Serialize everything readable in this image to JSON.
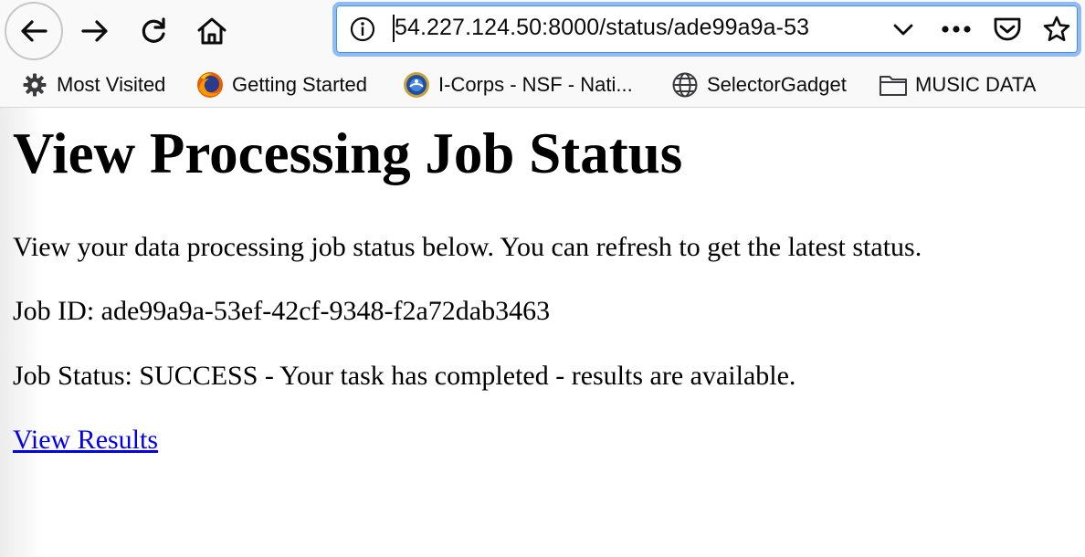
{
  "browser": {
    "url": "54.227.124.50:8000/status/ade99a9a-53",
    "icons": {
      "back": "back-arrow-icon",
      "forward": "forward-arrow-icon",
      "reload": "reload-icon",
      "home": "home-icon",
      "info": "info-icon",
      "dropdown": "chevron-down-icon",
      "more": "more-dots-icon",
      "pocket": "pocket-icon",
      "bookmark": "star-icon"
    },
    "accent_color": "#8fbcf5"
  },
  "bookmarks": [
    {
      "label": "Most Visited",
      "icon": "gear-icon"
    },
    {
      "label": "Getting Started",
      "icon": "firefox-icon"
    },
    {
      "label": "I-Corps - NSF - Nati...",
      "icon": "nsf-seal-icon"
    },
    {
      "label": "SelectorGadget",
      "icon": "globe-icon"
    },
    {
      "label": "MUSIC DATA",
      "icon": "folder-icon"
    }
  ],
  "page": {
    "title": "View Processing Job Status",
    "intro": "View your data processing job status below. You can refresh to get the latest status.",
    "job_id": "Job ID: ade99a9a-53ef-42cf-9348-f2a72dab3463",
    "job_status": "Job Status: SUCCESS - Your task has completed - results are available.",
    "results_link": "View Results",
    "link_color": "#0000ee"
  }
}
